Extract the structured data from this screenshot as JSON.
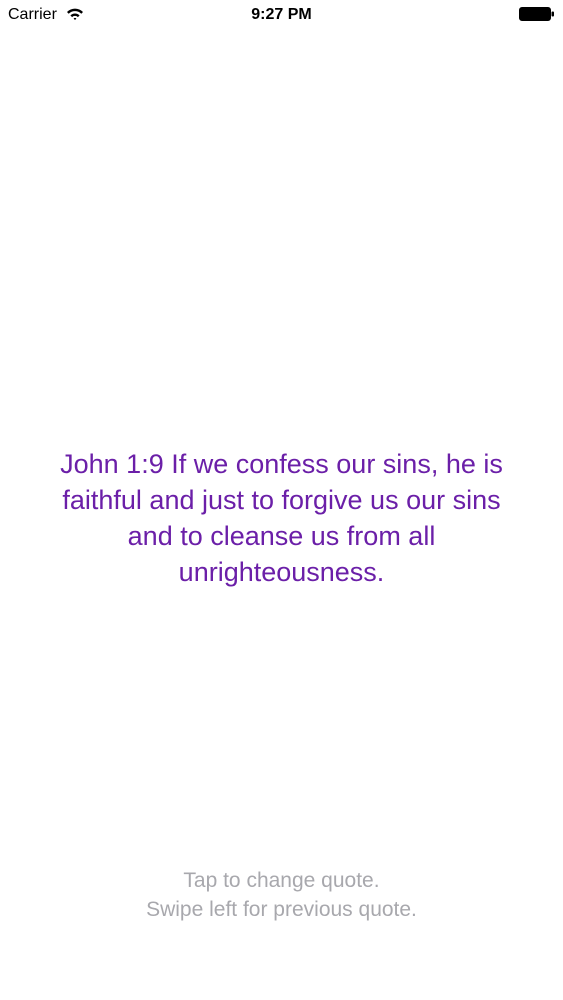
{
  "status_bar": {
    "carrier": "Carrier",
    "time": "9:27 PM",
    "wifi_icon": "wifi-icon",
    "battery_icon": "battery-icon"
  },
  "quote": {
    "text": "John 1:9 If we confess our sins, he is faithful and just to forgive us our sins and to cleanse us from all unrighteousness.",
    "color": "#6b1fa8"
  },
  "hints": {
    "line1": "Tap to change quote.",
    "line2": "Swipe left for previous quote.",
    "color": "#a8a8ad"
  }
}
